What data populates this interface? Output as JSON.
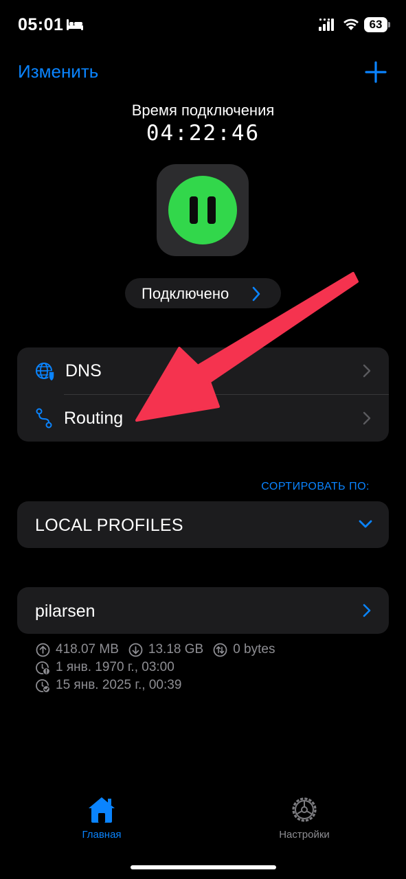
{
  "status_bar": {
    "time": "05:01",
    "battery": "63"
  },
  "nav": {
    "edit_label": "Изменить",
    "add_icon": "plus-icon"
  },
  "connection": {
    "label": "Время подключения",
    "elapsed": "04:22:46",
    "state": "Подключено",
    "toggle_icon": "pause-icon",
    "toggle_color": "#32d74b"
  },
  "settings": {
    "items": [
      {
        "label": "DNS",
        "icon": "globe-shield-icon"
      },
      {
        "label": "Routing",
        "icon": "route-icon"
      }
    ]
  },
  "sort": {
    "label": "СОРТИРОВАТЬ ПО:",
    "selected": "LOCAL PROFILES"
  },
  "profile": {
    "name": "pilarsen",
    "upload": "418.07 MB",
    "download": "13.18 GB",
    "total": "0 bytes",
    "created": "1 янв. 1970 г., 03:00",
    "updated": "15 янв. 2025 г., 00:39"
  },
  "tabs": [
    {
      "label": "Главная",
      "icon": "house-icon",
      "active": true
    },
    {
      "label": "Настройки",
      "icon": "gear-icon",
      "active": false
    }
  ],
  "colors": {
    "accent": "#0a84ff",
    "background": "#000000",
    "card": "#1c1c1e",
    "annotation_arrow": "#f5334f"
  }
}
